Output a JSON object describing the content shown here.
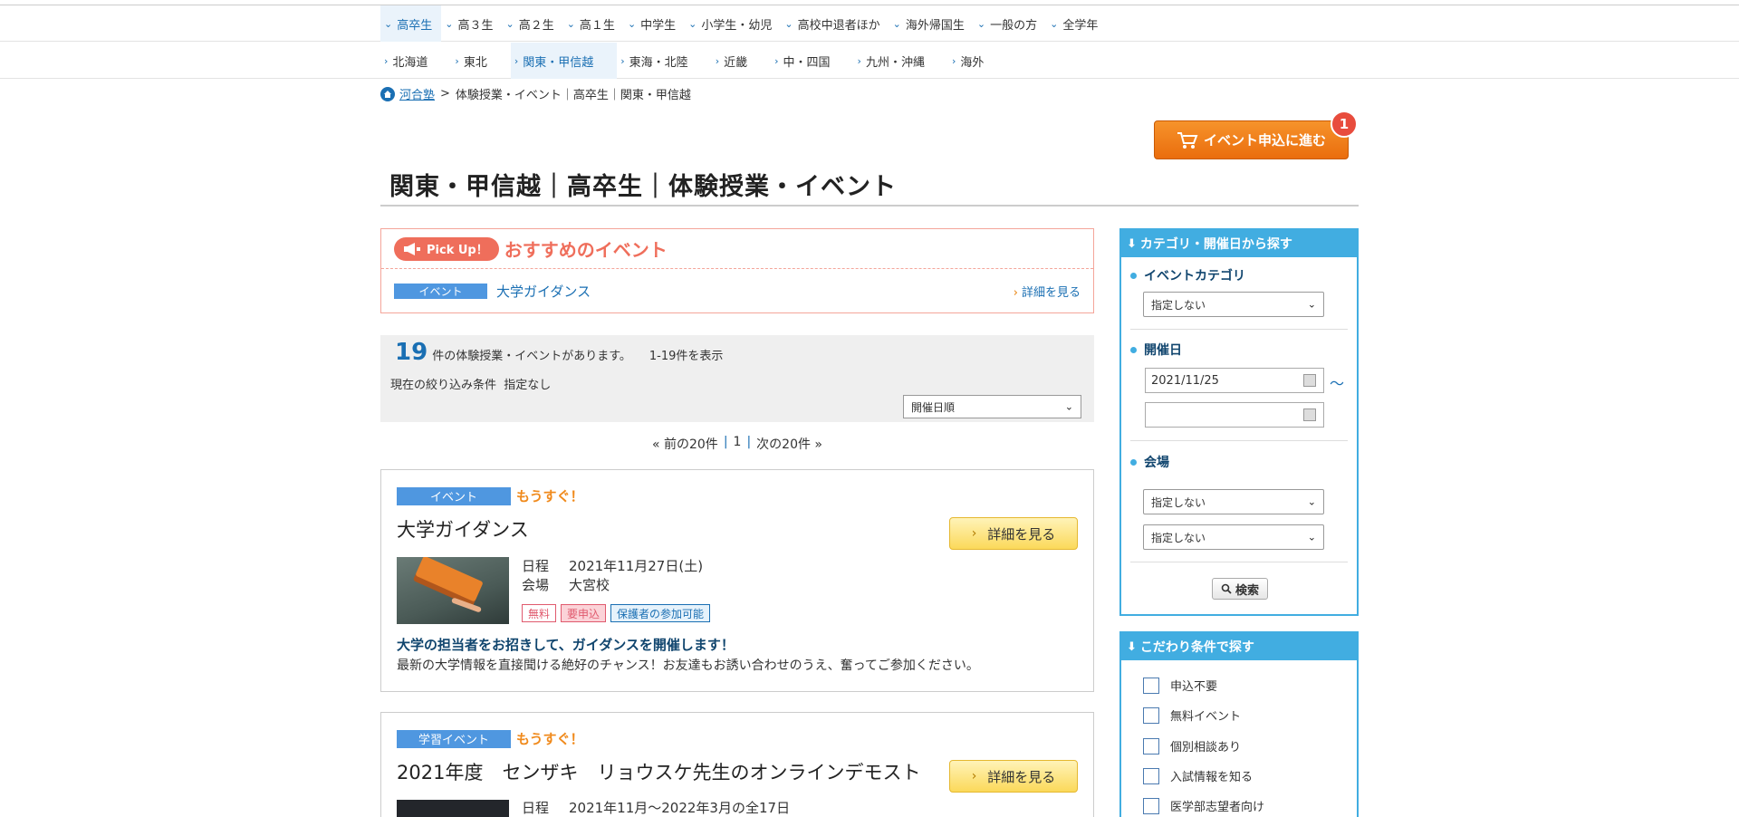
{
  "nav_top": [
    {
      "label": "高卒生",
      "active": true
    },
    {
      "label": "高３生"
    },
    {
      "label": "高２生"
    },
    {
      "label": "高１生"
    },
    {
      "label": "中学生"
    },
    {
      "label": "小学生・幼児"
    },
    {
      "label": "高校中退者ほか"
    },
    {
      "label": "海外帰国生"
    },
    {
      "label": "一般の方"
    },
    {
      "label": "全学年"
    }
  ],
  "nav_region": [
    {
      "label": "北海道"
    },
    {
      "label": "東北"
    },
    {
      "label": "関東・甲信越",
      "active": true
    },
    {
      "label": "東海・北陸"
    },
    {
      "label": "近畿"
    },
    {
      "label": "中・四国"
    },
    {
      "label": "九州・沖縄"
    },
    {
      "label": "海外"
    }
  ],
  "breadcrumb": {
    "home": "河合塾",
    "separator": ">",
    "current": "体験授業・イベント｜高卒生｜関東・甲信越"
  },
  "cart": {
    "label": "イベント申込に進む",
    "count": "1"
  },
  "page_title": "関東・甲信越｜高卒生｜体験授業・イベント",
  "pickup": {
    "badge": "Pick Up！",
    "title": "おすすめのイベント",
    "item_tag": "イベント",
    "item_name": "大学ガイダンス",
    "more": "詳細を見る"
  },
  "results": {
    "count": "19",
    "count_text": "件の体験授業・イベントがあります。",
    "range": "1-19件を表示",
    "filter_label": "現在の絞り込み条件",
    "filter_value": "指定なし",
    "sort_selected": "開催日順"
  },
  "pager": {
    "prev": "« 前の20件",
    "sep": "|",
    "page": "1",
    "next": "次の20件 »"
  },
  "events": [
    {
      "tag": "イベント",
      "soon": "もうすぐ！",
      "title": "大学ガイダンス",
      "detail": "詳細を見る",
      "date_label": "日程",
      "date": "2021年11月27日(土)",
      "venue_label": "会場",
      "venue": "大宮校",
      "chips": [
        "無料",
        "要申込",
        "保護者の参加可能"
      ],
      "lead": "大学の担当者をお招きして、ガイダンスを開催します！",
      "desc": "最新の大学情報を直接聞ける絶好のチャンス！お友達もお誘い合わせのうえ、奮ってご参加ください。"
    },
    {
      "tag": "学習イベント",
      "soon": "もうすぐ！",
      "title": "2021年度　センザキ　リョウスケ先生のオンラインデモスト",
      "detail": "詳細を見る",
      "date_label": "日程",
      "date": "2021年11月～2022年3月の全17日"
    }
  ],
  "sidebar": {
    "search_head": "カテゴリ・開催日から探す",
    "category_label": "イベントカテゴリ",
    "category_value": "指定しない",
    "date_label": "開催日",
    "date_from": "2021/11/25",
    "date_to": "",
    "tilde": "～",
    "venue_label": "会場",
    "venue_value1": "指定しない",
    "venue_value2": "指定しない",
    "search_button": "検索",
    "filter_head": "こだわり条件で探す",
    "checkboxes": [
      "申込不要",
      "無料イベント",
      "個別相談あり",
      "入試情報を知る",
      "医学部志望者向け"
    ]
  },
  "colors": {
    "brand_blue": "#1a6fb3",
    "sidebar_blue": "#41ade1",
    "cart_orange": "#ea6d0d",
    "pickup_red": "#ef6e5b",
    "soon_orange": "#f08a1c"
  }
}
